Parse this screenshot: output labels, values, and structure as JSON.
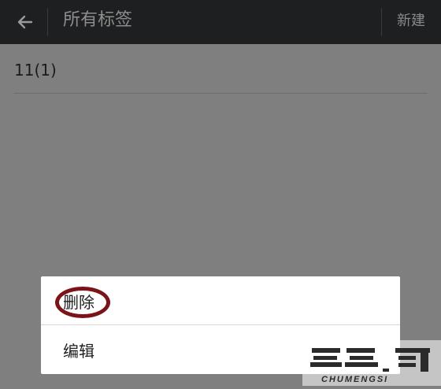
{
  "header": {
    "back_icon": "arrow-left-icon",
    "title": "所有标签",
    "new_label": "新建"
  },
  "tags": [
    {
      "label": "11(1)"
    }
  ],
  "context_menu": {
    "items": [
      {
        "label": "删除"
      },
      {
        "label": "编辑"
      }
    ]
  },
  "watermark": {
    "brand_cn": "楚梦思",
    "brand_en": "CHUMENGSI"
  },
  "colors": {
    "topbar": "#1e1f20",
    "dim_overlay": "#7f7f7f",
    "annotation_circle": "#7a1417"
  }
}
